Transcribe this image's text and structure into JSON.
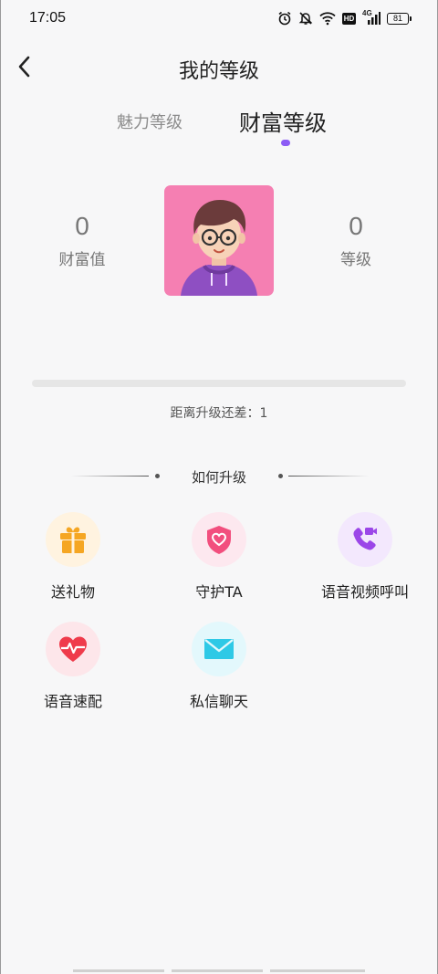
{
  "status_bar": {
    "time": "17:05",
    "network": "4G",
    "hd": "HD",
    "battery": "81",
    "icons": [
      "alarm-icon",
      "mute-icon",
      "wifi-icon",
      "hd-icon",
      "signal-icon",
      "battery-icon"
    ]
  },
  "header": {
    "title": "我的等级",
    "back_icon": "chevron-left-icon"
  },
  "tabs": [
    {
      "label": "魅力等级",
      "active": false
    },
    {
      "label": "财富等级",
      "active": true
    }
  ],
  "profile": {
    "wealth_value": "0",
    "wealth_label": "财富值",
    "level_value": "0",
    "level_label": "等级"
  },
  "progress": {
    "fraction": 0,
    "text": "距离升级还差：1"
  },
  "section": {
    "title": "如何升级"
  },
  "features": [
    {
      "label": "送礼物",
      "icon": "gift-icon"
    },
    {
      "label": "守护TA",
      "icon": "shield-heart-icon"
    },
    {
      "label": "语音视频呼叫",
      "icon": "phone-video-icon"
    },
    {
      "label": "语音速配",
      "icon": "heart-pulse-icon"
    },
    {
      "label": "私信聊天",
      "icon": "mail-icon"
    }
  ],
  "colors": {
    "accent": "#8c5cf5",
    "gift": "#f5a623",
    "shield": "#f24f7e",
    "phone": "#9b46e8",
    "heart": "#ef3b4b",
    "mail": "#2ec9e6"
  }
}
